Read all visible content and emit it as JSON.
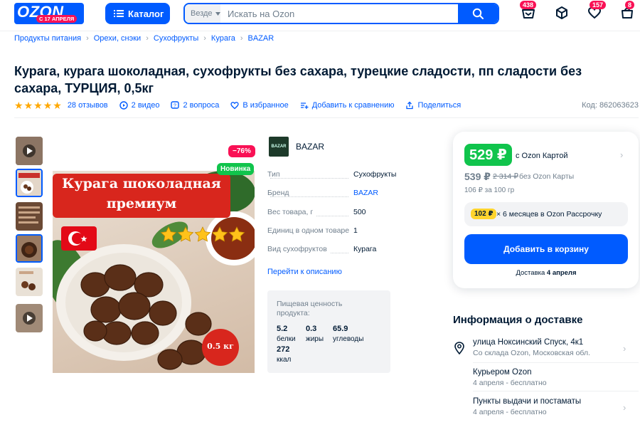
{
  "header": {
    "logo_text": "OZON",
    "logo_tag": "С 17 АПРЕЛЯ",
    "catalog_label": "Каталог",
    "search_scope": "Везде",
    "search_placeholder": "Искать на Ozon",
    "badges": {
      "orders": "438",
      "favorites": "157",
      "cart": "8"
    }
  },
  "breadcrumbs": [
    "Продукты питания",
    "Орехи, снэки",
    "Сухофрукты",
    "Курага",
    "BAZAR"
  ],
  "product": {
    "title": "Курага, курага шоколадная, сухофрукты без сахара, турецкие сладости, пп сладости без сахара, ТУРЦИЯ, 0,5кг",
    "reviews": "28 отзывов",
    "videos": "2 видео",
    "questions": "2 вопроса",
    "favorite": "В избранное",
    "compare": "Добавить к сравнению",
    "share": "Поделиться",
    "code": "Код: 862063623",
    "rating": 5,
    "discount_badge": "−76%",
    "new_badge": "Новинка",
    "image_banner_line1": "Курага шоколадная",
    "image_banner_line2": "премиум",
    "image_weight": "0.5 кг"
  },
  "seller": {
    "name": "BAZAR",
    "logo_text": "BAZAR"
  },
  "specs": [
    {
      "k": "Тип",
      "v": "Сухофрукты"
    },
    {
      "k": "Бренд",
      "v": "BAZAR"
    },
    {
      "k": "Вес товара, г",
      "v": "500"
    },
    {
      "k": "Единиц в одном товаре",
      "v": "1"
    },
    {
      "k": "Вид сухофруктов",
      "v": "Курага"
    }
  ],
  "description_link": "Перейти к описанию",
  "nutrition": {
    "label": "Пищевая ценность продукта:",
    "protein_v": "5.2",
    "protein_u": "белки",
    "fat_v": "0.3",
    "fat_u": "жиры",
    "carbs_v": "65.9",
    "carbs_u": "углеводы",
    "kcal_v": "272",
    "kcal_u": "ккал"
  },
  "price": {
    "card_price": "529 ₽",
    "card_caption": "с Ozon Картой",
    "regular_price": "539 ₽",
    "old_price": "2 314 ₽",
    "regular_caption": "без Ozon Карты",
    "unit_price": "106 ₽ за 100 гр",
    "installment_badge": "102 ₽",
    "installment_text": "× 6 месяцев в Ozon Рассрочку",
    "add_to_cart": "Добавить в корзину",
    "delivery_prefix": "Доставка ",
    "delivery_date": "4 апреля"
  },
  "delivery": {
    "heading": "Информация о доставке",
    "address": "улица Ноксинский Спуск, 4к1",
    "address_sub": "Со склада Ozon, Московская обл.",
    "courier": "Курьером Ozon",
    "courier_sub": "4 апреля - бесплатно",
    "pickup": "Пункты выдачи и постаматы",
    "pickup_sub": "4 апреля - бесплатно"
  },
  "colors": {
    "brand": "#005bff",
    "accent": "#f91155",
    "green": "#10c44c",
    "yellow": "#ffd42d"
  }
}
